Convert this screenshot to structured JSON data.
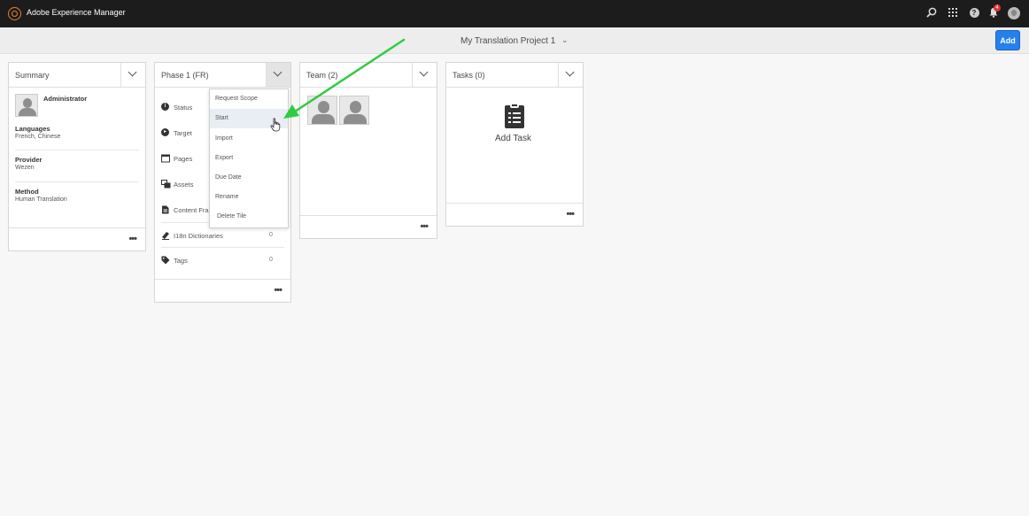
{
  "app": {
    "title": "Adobe Experience Manager",
    "notification_count": "4"
  },
  "header": {
    "project_title": "My Translation Project 1",
    "add_label": "Add"
  },
  "summary": {
    "title": "Summary",
    "owner": "Administrator",
    "languages_label": "Languages",
    "languages_value": "French, Chinese",
    "provider_label": "Provider",
    "provider_value": "Wezen",
    "method_label": "Method",
    "method_value": "Human Translation",
    "more": "•••"
  },
  "phase": {
    "title": "Phase 1 (FR)",
    "rows": [
      {
        "label": "Status",
        "count": ""
      },
      {
        "label": "Target",
        "count": ""
      },
      {
        "label": "Pages",
        "count": ""
      },
      {
        "label": "Assets",
        "count": ""
      },
      {
        "label": "Content Fra",
        "count": ""
      },
      {
        "label": "I18n Dictionaries",
        "count": "0"
      },
      {
        "label": "Tags",
        "count": "0"
      }
    ],
    "more": "•••"
  },
  "phase_menu": {
    "items": [
      "Request Scope",
      "Start",
      "Import",
      "Export",
      "Due Date",
      "Rename",
      "Delete Tile"
    ],
    "hovered": "Start"
  },
  "team": {
    "title": "Team (2)",
    "more": "•••"
  },
  "tasks": {
    "title": "Tasks (0)",
    "add_task": "Add Task",
    "more": "•••"
  },
  "colors": {
    "topbar": "#1c1c1c",
    "accent": "#2680eb",
    "annotation_arrow": "#2ecc40",
    "logo": "#e8812b"
  },
  "icons": [
    "search-icon",
    "apps-grid-icon",
    "help-icon",
    "bell-icon",
    "user-avatar-icon",
    "chevron-down-icon",
    "more-icon",
    "clipboard-task-icon"
  ]
}
